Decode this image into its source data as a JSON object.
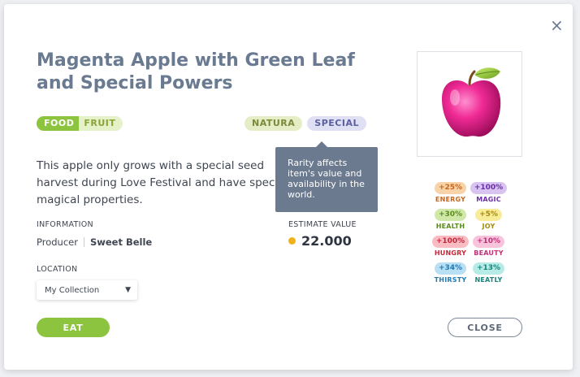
{
  "modal": {
    "title": "Magenta Apple with Green Leaf and Special Powers",
    "close_icon": "×"
  },
  "tags": {
    "category": "FOOD",
    "subcategory": "FRUIT",
    "type": "NATURA",
    "rarity": "SPECIAL"
  },
  "description": "This apple only grows with a special seed harvest during Love Festival and have special magical properties.",
  "tooltip": {
    "text": "Rarity affects item's value and availability in the world."
  },
  "information": {
    "label": "INFORMATION",
    "producer_label": "Producer",
    "producer_name": "Sweet Belle"
  },
  "estimate": {
    "label": "ESTIMATE VALUE",
    "value": "22.000",
    "coin_color": "#f0b21a"
  },
  "location": {
    "label": "LOCATION",
    "selected": "My Collection",
    "caret_icon": "▼"
  },
  "stats": [
    {
      "value": "+25%",
      "name": "ENERGY",
      "bg": "#f9d3a8",
      "fg": "#c7661c"
    },
    {
      "value": "+100%",
      "name": "MAGIC",
      "bg": "#d9c3f1",
      "fg": "#6a2fa7"
    },
    {
      "value": "+30%",
      "name": "HEALTH",
      "bg": "#cfe8a8",
      "fg": "#5a8c1c"
    },
    {
      "value": "+5%",
      "name": "JOY",
      "bg": "#f8ec98",
      "fg": "#a48a10"
    },
    {
      "value": "+100%",
      "name": "HUNGRY",
      "bg": "#f9bcc3",
      "fg": "#c4283b"
    },
    {
      "value": "+10%",
      "name": "BEAUTY",
      "bg": "#f7c4dc",
      "fg": "#c2307a"
    },
    {
      "value": "+34%",
      "name": "THIRSTY",
      "bg": "#b9dff4",
      "fg": "#1f7bb6"
    },
    {
      "value": "+13%",
      "name": "NEATLY",
      "bg": "#b6ebe6",
      "fg": "#16857e"
    }
  ],
  "buttons": {
    "eat": "EAT",
    "close": "CLOSE"
  },
  "colors": {
    "accent_green": "#8cc43f",
    "title": "#6a7a91"
  }
}
